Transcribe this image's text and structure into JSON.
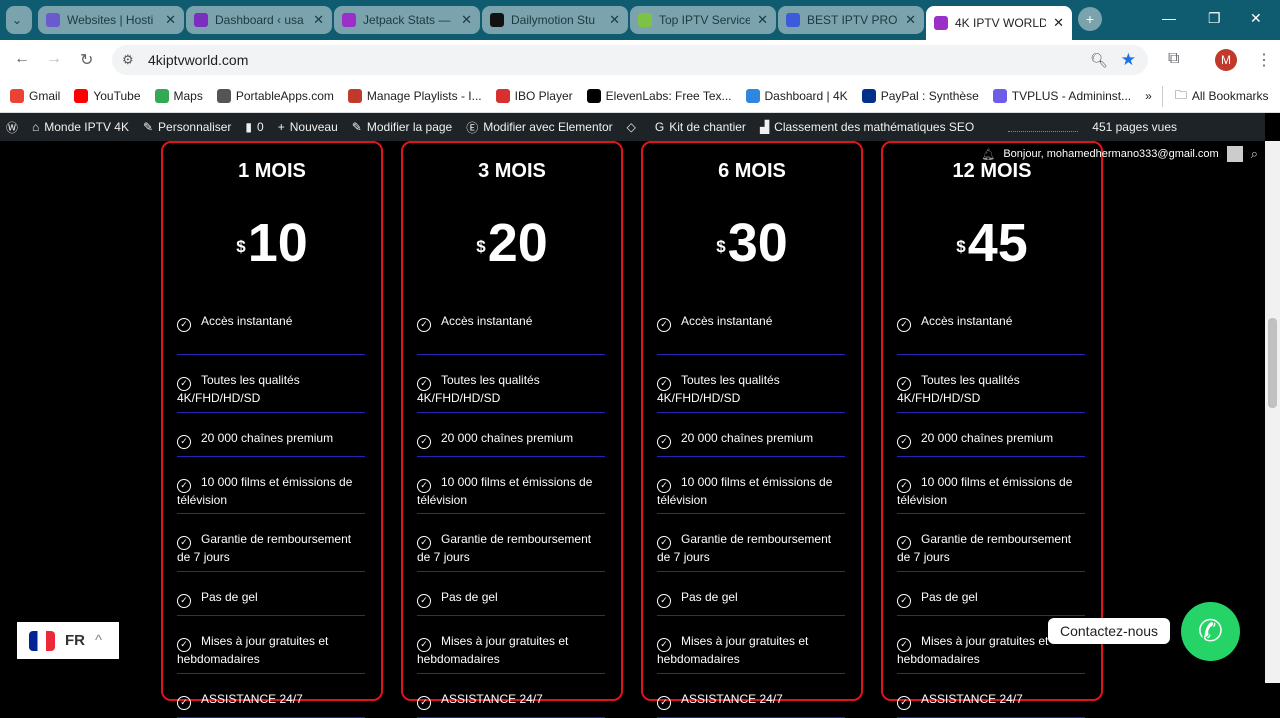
{
  "browser": {
    "tabs": [
      {
        "title": "Websites | Hosti",
        "color": "#6a5acd"
      },
      {
        "title": "Dashboard ‹ usa",
        "color": "#7b2fbf"
      },
      {
        "title": "Jetpack Stats —",
        "color": "#9b30c8"
      },
      {
        "title": "Dailymotion Stu",
        "color": "#111111"
      },
      {
        "title": "Top IPTV Service",
        "color": "#7dc242"
      },
      {
        "title": "BEST IPTV PROV",
        "color": "#3b5bdb"
      },
      {
        "title": "4K IPTV WORLD",
        "color": "#9b30c8",
        "active": true
      }
    ],
    "url": "4kiptvworld.com",
    "profile_initial": "M",
    "bookmarks": [
      {
        "label": "Gmail",
        "color": "#ea4335"
      },
      {
        "label": "YouTube",
        "color": "#ff0000"
      },
      {
        "label": "Maps",
        "color": "#34a853"
      },
      {
        "label": "PortableApps.com",
        "color": "#555555"
      },
      {
        "label": "Manage Playlists - I...",
        "color": "#c0392b"
      },
      {
        "label": "IBO Player",
        "color": "#d63031"
      },
      {
        "label": "ElevenLabs: Free Tex...",
        "color": "#000000"
      },
      {
        "label": "Dashboard | 4K",
        "color": "#2e86de"
      },
      {
        "label": "PayPal : Synthèse",
        "color": "#003087"
      },
      {
        "label": "TVPLUS - Admininst...",
        "color": "#6c5ce7"
      }
    ],
    "all_bookmarks": "All Bookmarks"
  },
  "admin_bar": {
    "items": [
      "Monde IPTV 4K",
      "Personnaliser",
      "0",
      "Nouveau",
      "Modifier la page",
      "Modifier avec Elementor",
      "",
      "Kit de chantier",
      "Classement des mathématiques SEO"
    ],
    "views": "451 pages vues",
    "greeting": "Bonjour, mohamedhermano333@gmail.com"
  },
  "plans": [
    {
      "name": "1 MOIS",
      "currency": "$",
      "price": "10"
    },
    {
      "name": "3 MOIS",
      "currency": "$",
      "price": "20"
    },
    {
      "name": "6 MOIS",
      "currency": "$",
      "price": "30"
    },
    {
      "name": "12 MOIS",
      "currency": "$",
      "price": "45"
    }
  ],
  "features": [
    "Accès instantané",
    "Toutes les qualités 4K/FHD/HD/SD",
    "20 000 chaînes premium",
    "10 000 films et émissions de télévision",
    "Garantie de remboursement de 7 jours",
    "Pas de gel",
    "Mises à jour gratuites et hebdomadaires",
    "ASSISTANCE 24/7"
  ],
  "colors": {
    "card_border": "#e0151b",
    "divider": "#2525b8",
    "whatsapp": "#25d366"
  },
  "language": {
    "code": "FR"
  },
  "contact": {
    "label": "Contactez-nous"
  }
}
